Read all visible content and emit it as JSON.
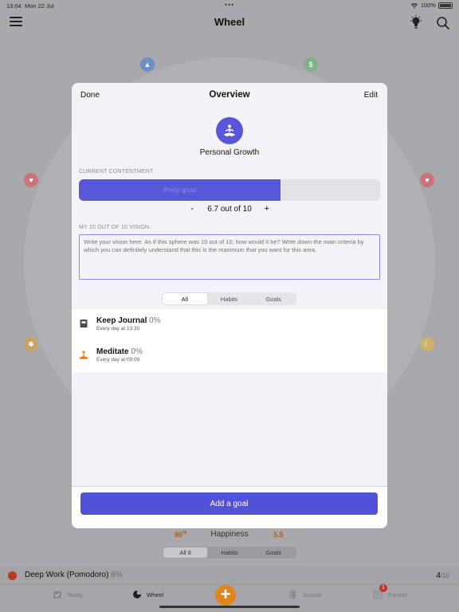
{
  "status_bar": {
    "time": "13:04",
    "date": "Mon 22 Jul",
    "battery": "100%"
  },
  "nav": {
    "title": "Wheel"
  },
  "modal": {
    "done_label": "Done",
    "title": "Overview",
    "edit_label": "Edit",
    "sphere_name": "Personal Growth",
    "contentment": {
      "section_label": "CURRENT CONTENTMENT",
      "bar_label": "Pretty good",
      "value": 6.7,
      "value_text": "6.7 out of 10",
      "minus_label": "-",
      "plus_label": "+"
    },
    "vision": {
      "section_label": "MY 10 OUT OF 10 VISION",
      "placeholder": "Write your vision here. As if this sphere was 10 out of 10, how would it be? Write down the main criteria by which you can definitely understand that this is the maximum that you want for this area."
    },
    "filter": {
      "all": "All",
      "habits": "Habits",
      "goals": "Goals",
      "selected": "All"
    },
    "items": [
      {
        "title": "Keep Journal",
        "percent": "0%",
        "schedule": "Every day at 13:30",
        "icon": "journal-icon"
      },
      {
        "title": "Meditate",
        "percent": "0%",
        "schedule": "Every day at 09:00",
        "icon": "meditation-icon"
      }
    ],
    "add_goal_label": "Add a goal"
  },
  "background": {
    "stats": {
      "left_value": "80",
      "left_unit": "%",
      "center_label": "Happiness",
      "right_value": "5.5"
    },
    "filter": {
      "all": "All 8",
      "habits": "Habits",
      "goals": "Goals"
    },
    "deep_work": {
      "name": "Deep Work (Pomodoro)",
      "percent": "6%",
      "count": "4",
      "total": "/10"
    }
  },
  "tabs": [
    {
      "label": "Today",
      "icon": "calendar-check-icon"
    },
    {
      "label": "Wheel",
      "icon": "pie-chart-icon"
    },
    {
      "label": "Journal",
      "icon": "book-icon"
    },
    {
      "label": "Tracker",
      "icon": "grid-calendar-icon",
      "badge": "1"
    }
  ],
  "colors": {
    "accent": "#5757d8",
    "orange": "#e0851a"
  }
}
